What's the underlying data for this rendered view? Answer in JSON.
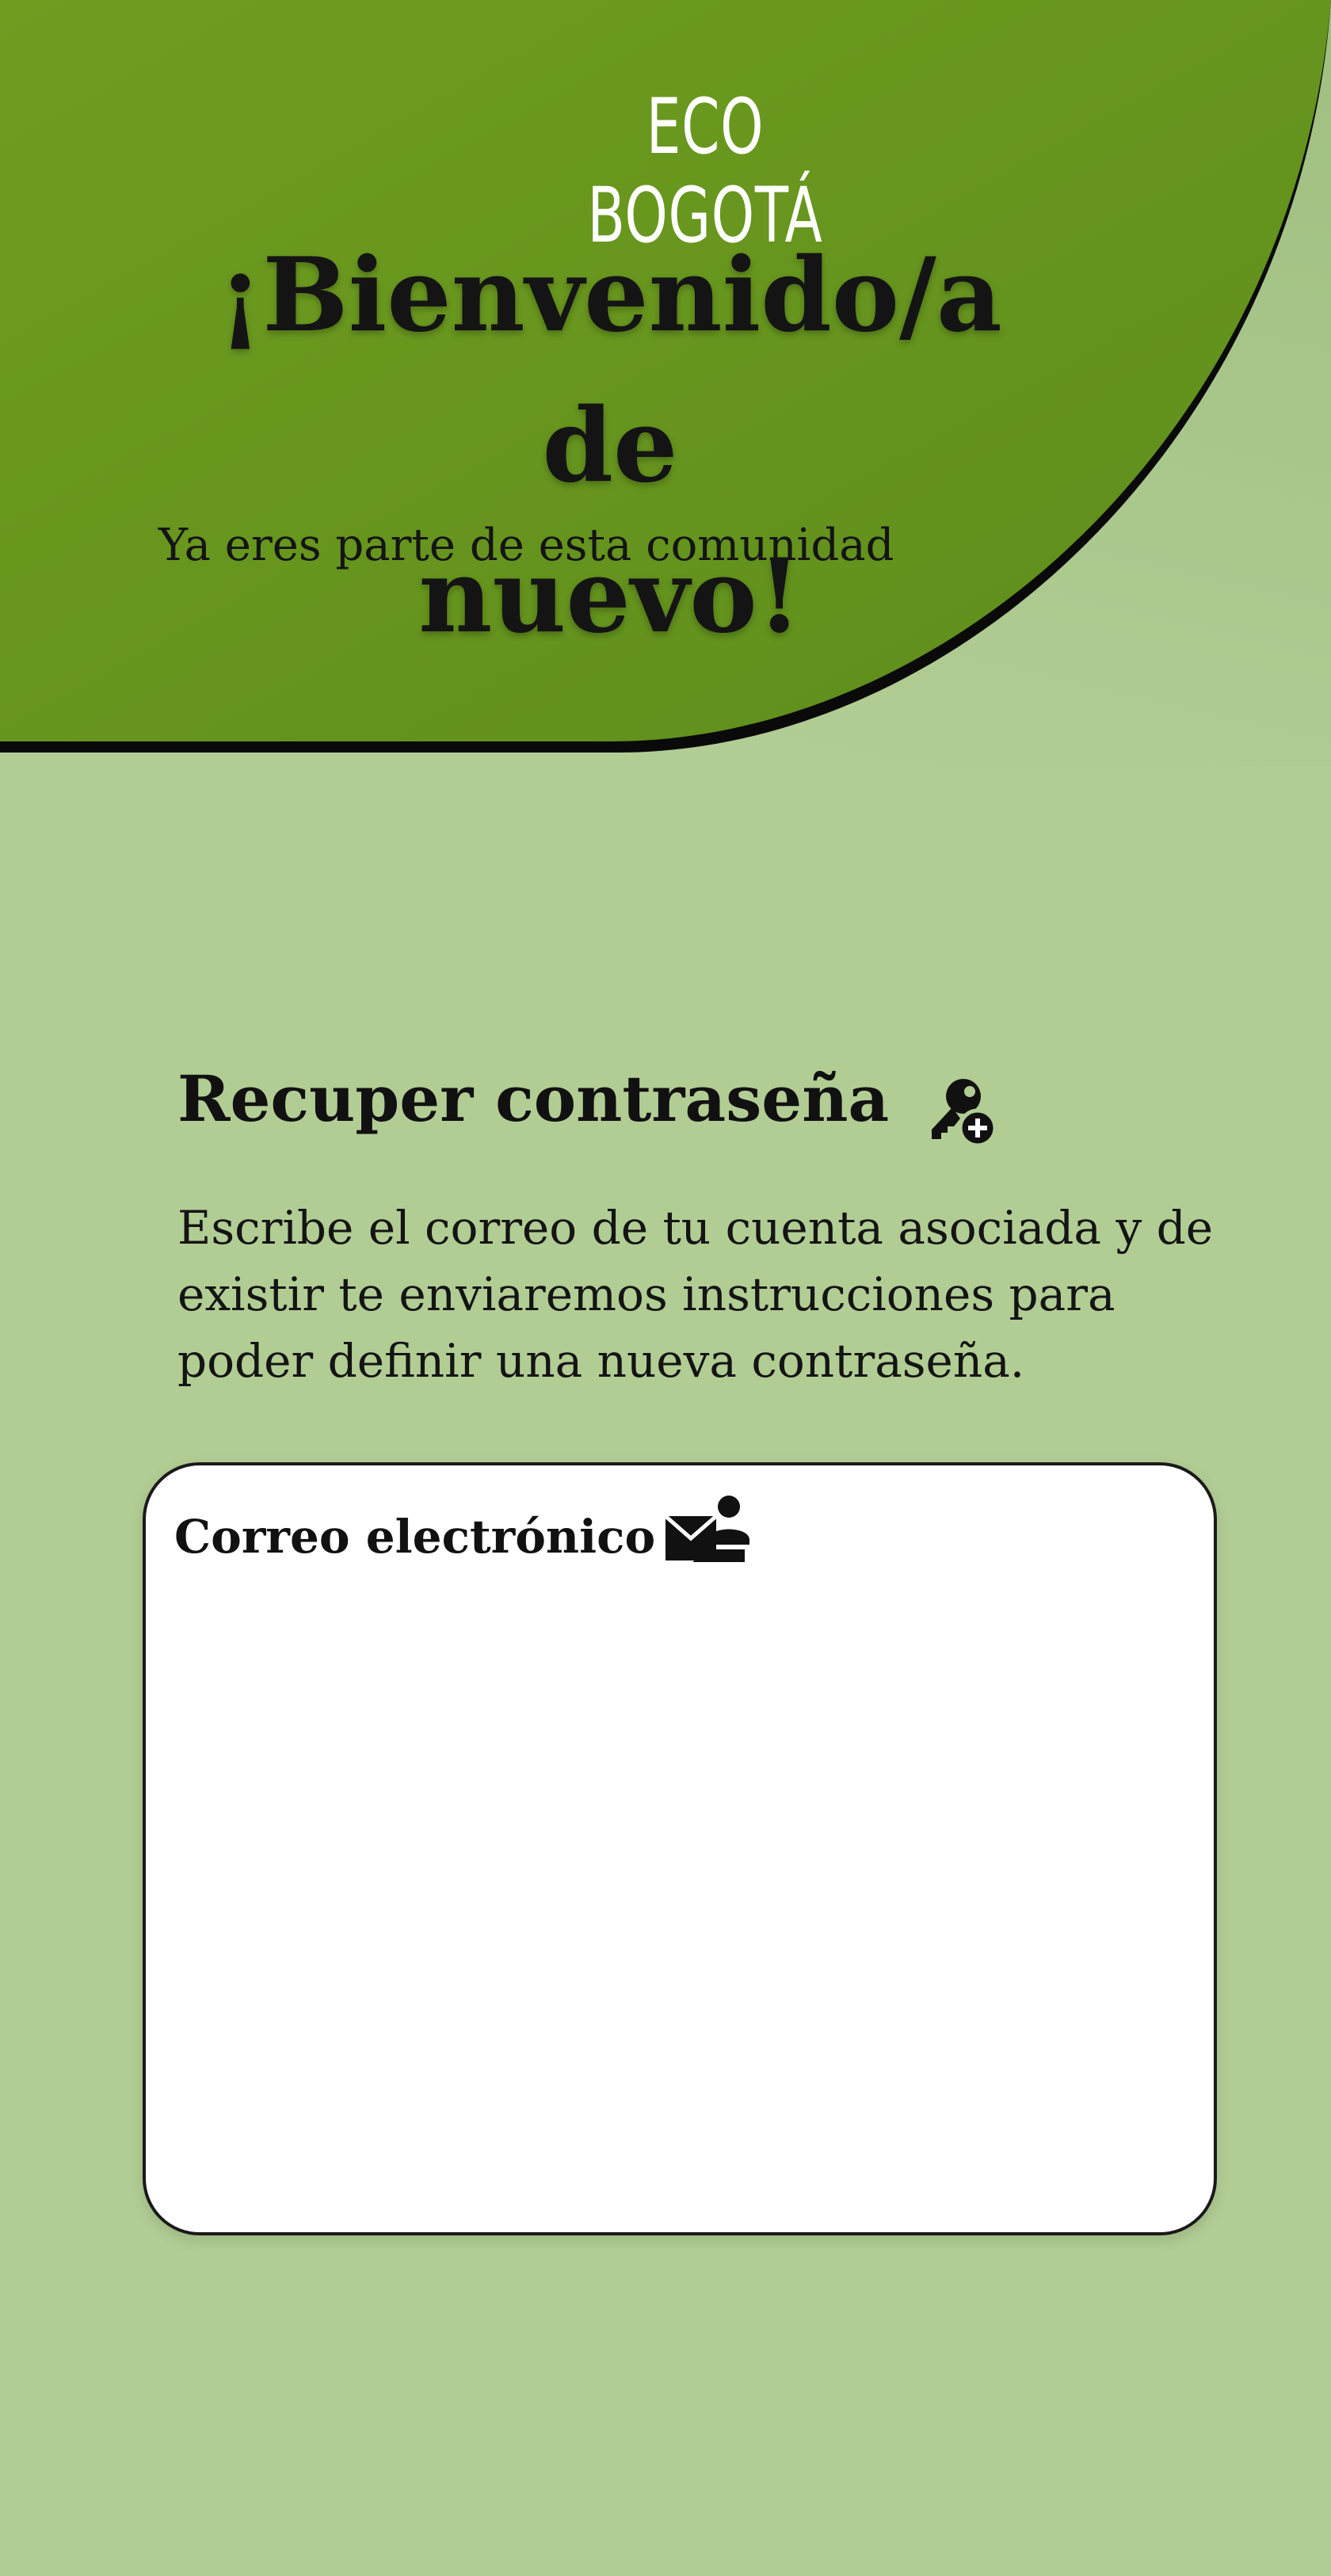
{
  "colors": {
    "page_background": "#b2cd94",
    "hero_green": "#6b9a1f",
    "input_background": "#ffffff"
  },
  "header": {
    "brand": "ECO BOGOTÁ",
    "welcome_line1": "¡Bienvenido/a de",
    "welcome_line2": "nuevo!",
    "subtitle": "Ya eres parte de esta comunidad"
  },
  "recovery": {
    "title": "Recuper contraseña",
    "title_icon": "key-add-icon",
    "instructions": "Escribe el correo de tu cuenta asociada y de existir te enviaremos instrucciones para poder definir una nueva contraseña.",
    "email_label": "Correo electrónico",
    "email_icon": "mail-user-icon",
    "email_value": ""
  }
}
